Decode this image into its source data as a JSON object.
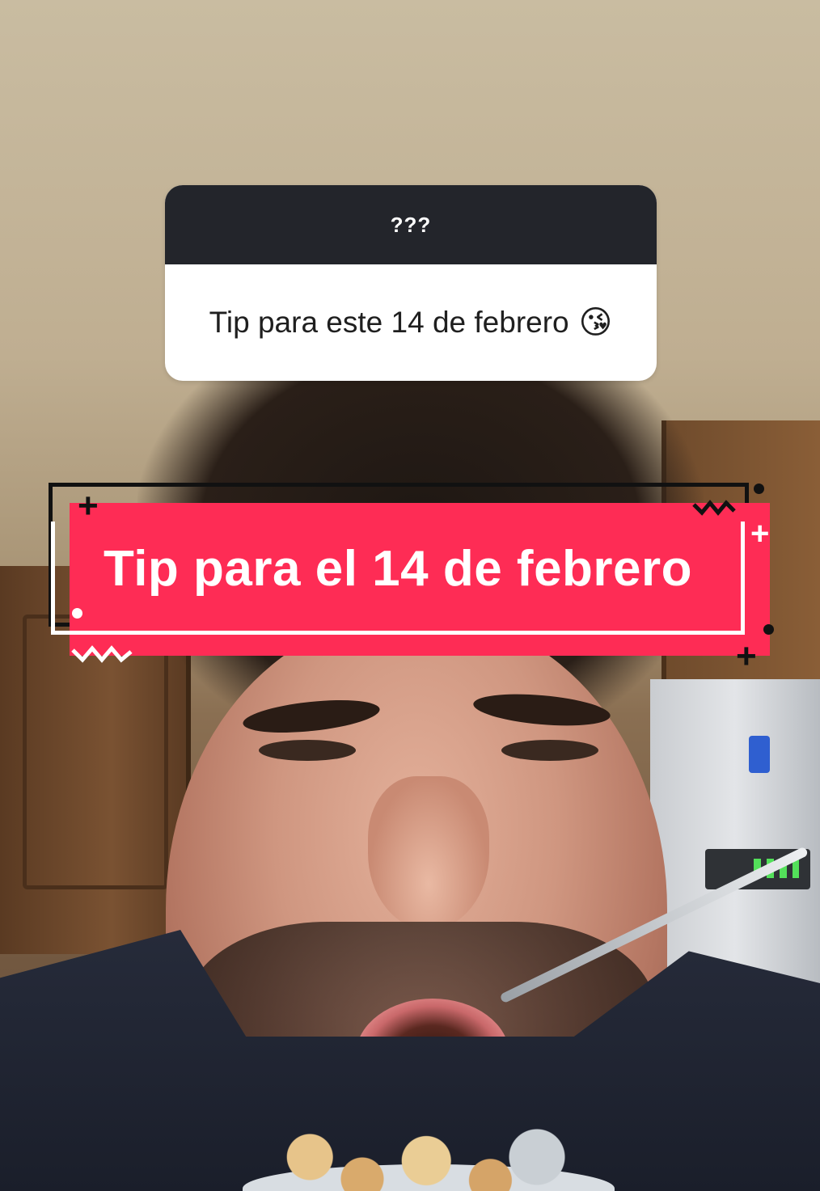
{
  "question_sticker": {
    "header": "???",
    "question": "Tip para este 14 de febrero",
    "emoji_icon": "kissing-face-with-heart-emoji"
  },
  "caption": {
    "text": "Tip para el 14 de febrero",
    "background_color": "#fe2c55",
    "text_color": "#ffffff"
  }
}
